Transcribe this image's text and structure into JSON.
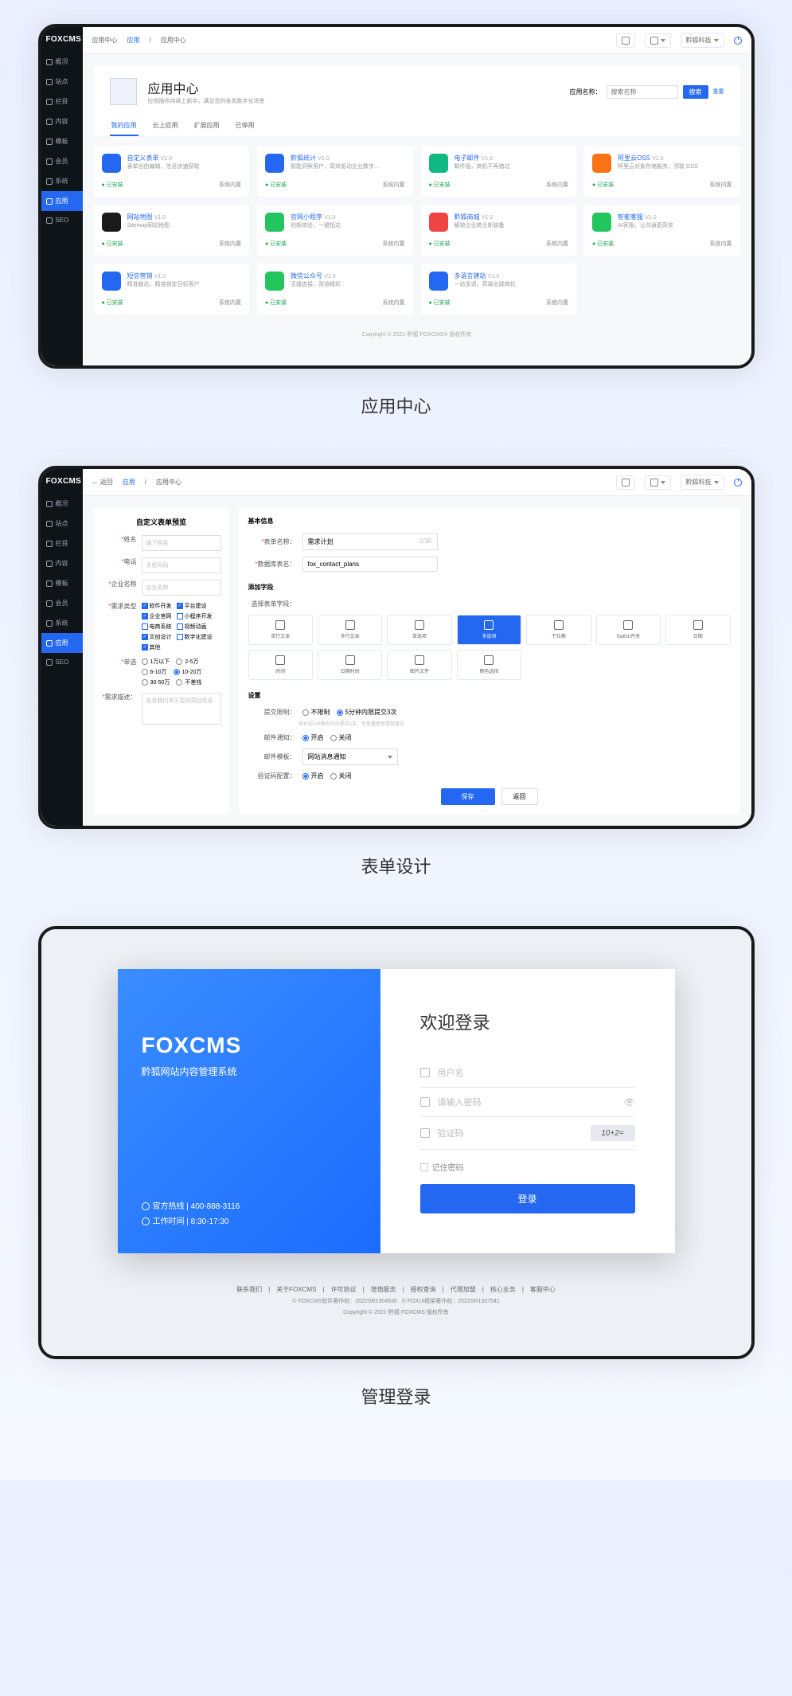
{
  "brand": "FOXCMS",
  "topbar": {
    "home_label": "应用中心",
    "breadcrumb1": "应用",
    "breadcrumb2": "应用中心",
    "back_label": "返回",
    "user": "黔狐科技"
  },
  "sidebar": {
    "items": [
      "概况",
      "站点",
      "栏目",
      "内容",
      "模板",
      "会员",
      "系统",
      "应用",
      "SEO"
    ]
  },
  "hero": {
    "title": "应用中心",
    "sub": "应用插件持续上新中，满足您的各类数字化场景",
    "search_label": "应用名称：",
    "search_ph": "搜索名称",
    "search_btn": "搜索",
    "reset": "重置",
    "tabs": [
      "我的应用",
      "云上应用",
      "扩展应用",
      "已停用"
    ]
  },
  "apps": [
    {
      "name": "自定义表单",
      "v": "V1.0",
      "desc": "表单自由编辑，信息快速获取",
      "color": "#2468f2"
    },
    {
      "name": "黔狐统计",
      "v": "V1.0",
      "desc": "智能洞察用户，高效驱动企业数字...",
      "color": "#2468f2"
    },
    {
      "name": "电子邮件",
      "v": "V1.0",
      "desc": "邮件隐，商机不再错过",
      "color": "#10b981"
    },
    {
      "name": "阿里云OSS",
      "v": "V1.0",
      "desc": "阿里云对象存储服务，须联 OSS",
      "color": "#f97316"
    },
    {
      "name": "网站地图",
      "v": "V1.0",
      "desc": "Sitemap网站地图",
      "color": "#1a1a1a"
    },
    {
      "name": "官网小程序",
      "v": "V1.0",
      "desc": "创新体验，一键抵达",
      "color": "#22c55e"
    },
    {
      "name": "黔狐商城",
      "v": "V1.0",
      "desc": "解锁企业商业新装备",
      "color": "#ef4444"
    },
    {
      "name": "智能客服",
      "v": "V1.0",
      "desc": "AI客服，让沟通更高效",
      "color": "#22c55e"
    },
    {
      "name": "短信营销",
      "v": "V1.0",
      "desc": "精准触达，精准锁定目标客户",
      "color": "#2468f2"
    },
    {
      "name": "微信公众号",
      "v": "V1.0",
      "desc": "无缝连接，双倍精彩",
      "color": "#22c55e"
    },
    {
      "name": "多语言建站",
      "v": "V1.0",
      "desc": "一站多语，高端全球商机",
      "color": "#2468f2"
    }
  ],
  "app_status": {
    "installed": "已安装",
    "builtin": "系统内置"
  },
  "copyright": "Copyright © 2021-黔狐 FOXCMS® 版权所有",
  "section1": "应用中心",
  "section2": "表单设计",
  "section3": "管理登录",
  "form": {
    "preview_title": "自定义表单预览",
    "rows": {
      "name": {
        "label": "姓名",
        "ph": "填下姓名"
      },
      "phone": {
        "label": "电话",
        "ph": "手机号码"
      },
      "company": {
        "label": "企业名称",
        "ph": "企业名称"
      },
      "need": {
        "label": "需求类型"
      },
      "budget": {
        "label": "单选"
      },
      "desc": {
        "label": "需求描述：",
        "ph": "告诉我们关于您的项目信息"
      }
    },
    "need_opts": [
      "软件开发",
      "平台建设",
      "企业官网",
      "小程序开发",
      "电商系统",
      "视频动画",
      "文创设计",
      "数字化建设",
      "其他"
    ],
    "need_checked": [
      true,
      true,
      true,
      false,
      false,
      false,
      true,
      false,
      true
    ],
    "budget_opts": [
      "1万以下",
      "2-5万",
      "6-10万",
      "10-20万",
      "30-50万",
      "不差钱"
    ],
    "budget_sel": 3,
    "right": {
      "basic": "基本信息",
      "r1_label": "表单名称：",
      "r1_val": "需求计划",
      "r1_count": "0/30",
      "r2_label": "数据库表名：",
      "r2_val": "fox_contact_plans",
      "add_field": "添加字段",
      "choose": "选择表单字段：",
      "fields": [
        "单行文本",
        "多行文本",
        "单选项",
        "多选项",
        "下拉框",
        "Switch开关",
        "日期",
        "时间",
        "日期时间",
        "图片文件",
        "颜色选择"
      ],
      "field_sel": 3,
      "settings": "设置",
      "s1_label": "提交限制：",
      "s1_opt1": "不限制",
      "s1_opt2": "5分钟内限提交3次",
      "s1_hint": "同IP在5分钟内只许提交3次，可免遭恶意提取留言",
      "s2_label": "邮件通知：",
      "s3_label": "邮件模板：",
      "s3_val": "网站消息通知",
      "s4_label": "验证码配置：",
      "on": "开启",
      "off": "关闭",
      "save": "保存",
      "back": "返回"
    }
  },
  "login": {
    "brand": "FOXCMS",
    "sub": "黔狐网站内容管理系统",
    "hotline_label": "官方热线",
    "hotline": "400-888-3116",
    "hours_label": "工作时间",
    "hours": "8:30-17:30",
    "title": "欢迎登录",
    "user_ph": "用户名",
    "pwd_ph": "请输入密码",
    "code_ph": "验证码",
    "captcha": "10+2=",
    "remember": "记住密码",
    "submit": "登录",
    "footer_links": [
      "联系我们",
      "关于FOXCMS",
      "许可协议",
      "增值服务",
      "授权查询",
      "代理加盟",
      "核心业务",
      "客服中心"
    ],
    "footer_ic1": "FOXCMS软件著作权：2022SR1304936",
    "footer_ic2": "FOXUI框架著作权：2022SR1337541",
    "footer_cp": "Copyright © 2021-黔狐 FOXCMS 版权所有"
  }
}
